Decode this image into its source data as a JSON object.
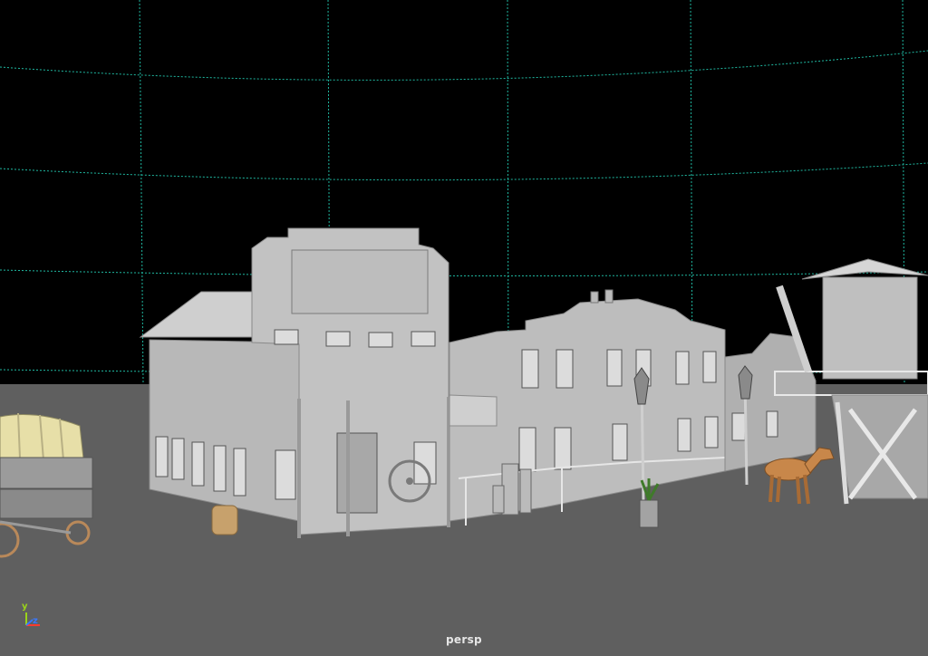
{
  "viewport": {
    "camera_name": "persp",
    "axis": {
      "y": "y",
      "z": "z"
    }
  },
  "colors": {
    "background": "#000000",
    "ground": "#5f5f5f",
    "grid_line": "#1fb7a0",
    "building": "#b3b3b3",
    "horse": "#c8874a",
    "wagon_cover": "#e7dfa8",
    "barrel": "#c7a16c"
  }
}
